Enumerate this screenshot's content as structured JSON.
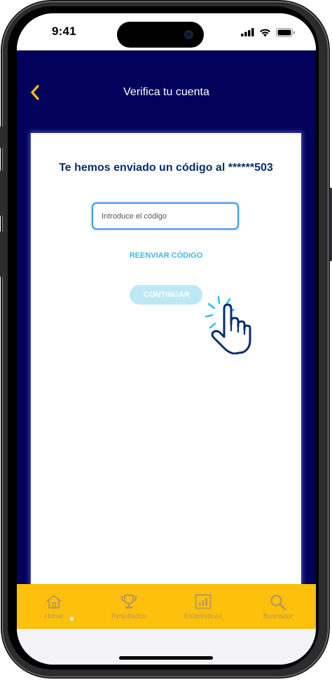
{
  "status_bar": {
    "time": "9:41",
    "icons": [
      "signal-icon",
      "wifi-icon",
      "battery-icon"
    ]
  },
  "header": {
    "title": "Verifica tu cuenta",
    "back_icon": "chevron-left-icon"
  },
  "verification": {
    "heading": "Te hemos enviado un código al ******503",
    "code_placeholder": "Introduce el código",
    "code_value": "",
    "resend_label": "REENVIAR CÓDIGO",
    "continue_label": "CONTINUAR"
  },
  "tab_bar": {
    "items": [
      {
        "label": "Home",
        "icon": "home-icon"
      },
      {
        "label": "Resultados",
        "icon": "trophy-icon"
      },
      {
        "label": "Estadísticas",
        "icon": "bar-chart-icon"
      },
      {
        "label": "Buscador",
        "icon": "search-icon"
      }
    ]
  },
  "colors": {
    "header_bg": "#02025a",
    "accent_yellow": "#fcc00d",
    "heading_text": "#0a2d6e",
    "link_blue": "#3fb8e6",
    "button_disabled": "#bde9f7"
  }
}
